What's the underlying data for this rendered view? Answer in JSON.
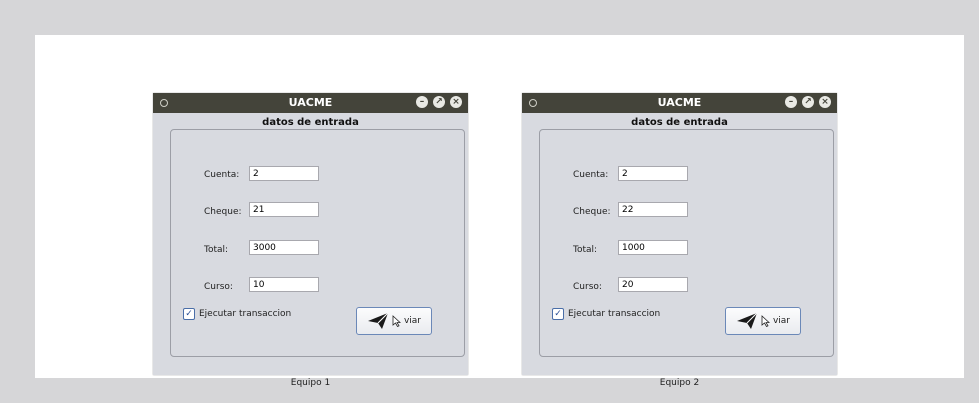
{
  "windows": [
    {
      "title": "UACME",
      "heading": "datos de entrada",
      "fields": [
        {
          "label": "Cuenta:",
          "value": "2"
        },
        {
          "label": "Cheque:",
          "value": "21"
        },
        {
          "label": "Total:",
          "value": "3000"
        },
        {
          "label": "Curso:",
          "value": "10"
        }
      ],
      "checkbox_label": "Ejecutar transaccion",
      "checkbox_checked": true,
      "send_label": "viar",
      "caption": "Equipo 1"
    },
    {
      "title": "UACME",
      "heading": "datos de entrada",
      "fields": [
        {
          "label": "Cuenta:",
          "value": "2"
        },
        {
          "label": "Cheque:",
          "value": "22"
        },
        {
          "label": "Total:",
          "value": "1000"
        },
        {
          "label": "Curso:",
          "value": "20"
        }
      ],
      "checkbox_label": "Ejecutar transaccion",
      "checkbox_checked": true,
      "send_label": "viar",
      "caption": "Equipo 2"
    }
  ],
  "icons": {
    "window_menu": "circle-icon",
    "minimize": "minimize-icon",
    "maximize": "maximize-icon",
    "close": "close-icon",
    "send": "paper-plane-icon",
    "cursor": "cursor-icon"
  },
  "colors": {
    "titlebar": "#44443a",
    "window_bg": "#d8dae0",
    "button_border": "#6b88b8",
    "page_bg": "#d6d6d8"
  }
}
